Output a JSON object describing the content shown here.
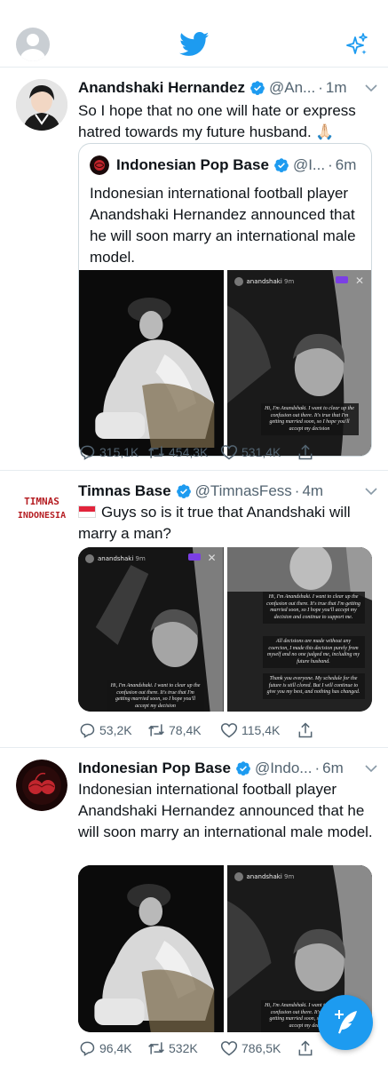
{
  "colors": {
    "accent": "#1d9bf0",
    "secondary_text": "#536471",
    "like_red": "#f91880"
  },
  "header": {
    "avatar_icon": "default-avatar-icon",
    "logo_icon": "twitter-bird-icon",
    "sparkle_icon": "sparkle-icon"
  },
  "tweets": [
    {
      "name": "Anandshaki Hernandez",
      "handle": "@An...",
      "sep": "·",
      "time": "1m",
      "text": "So I hope that no one will hate or express hatred towards my future husband. 🙏🏻",
      "quote": {
        "name": "Indonesian Pop Base",
        "handle": "@I...",
        "sep": "·",
        "time": "6m",
        "text": "Indonesian international football player Anandshaki Hernandez announced that he will soon marry an international male model.",
        "media": {
          "story_user": "anandshaki",
          "story_age": "9m",
          "caption": "Hi, I'm Anandshaki. I want to clear up the confusion out there. It's true that I'm getting married soon, so I hope you'll accept my decision"
        }
      },
      "replies": "315,1K",
      "retweets": "454,3K",
      "likes": "531,4K"
    },
    {
      "name": "Timnas Base",
      "handle": "@TimnasFess",
      "sep": "·",
      "time": "4m",
      "avatar_text_1": "TIMNAS",
      "avatar_text_2": "INDONESIA",
      "text": "Guys so is it true that Anandshaki will marry a man?",
      "media": {
        "story_user": "anandshaki",
        "story_age": "9m",
        "caption_left": "Hi, I'm Anandshaki. I want to clear up the confusion out there. It's true that I'm getting married soon, so I hope you'll accept my decision",
        "caption_right_1": "Hi, I'm Anandshaki. I want to clear up the confusion out there. It's true that I'm getting married soon, so I hope you'll accept my decision and continue to support me.",
        "caption_right_2": "All decisions are made without any coercion, I made this decision purely from myself and no one judged me, including my future husband.",
        "caption_right_3": "Thank you everyone. My schedule for the future is still clored. But I will continue to give you my best, and nothing has changed."
      },
      "replies": "53,2K",
      "retweets": "78,4K",
      "likes": "115,4K"
    },
    {
      "name": "Indonesian Pop Base",
      "handle": "@Indo...",
      "sep": "·",
      "time": "6m",
      "text": "Indonesian international football player Anandshaki Hernandez announced that he will soon marry an international male model.",
      "media": {
        "story_user": "anandshaki",
        "story_age": "9m",
        "caption": "Hi, I'm Anandshaki. I want to clear up the confusion out there. It's true that I'm getting married soon, so I hope you'll accept my decision"
      },
      "replies": "96,4K",
      "retweets": "532K",
      "likes": "786,5K"
    }
  ],
  "fab": {
    "icon": "compose-tweet-icon"
  }
}
